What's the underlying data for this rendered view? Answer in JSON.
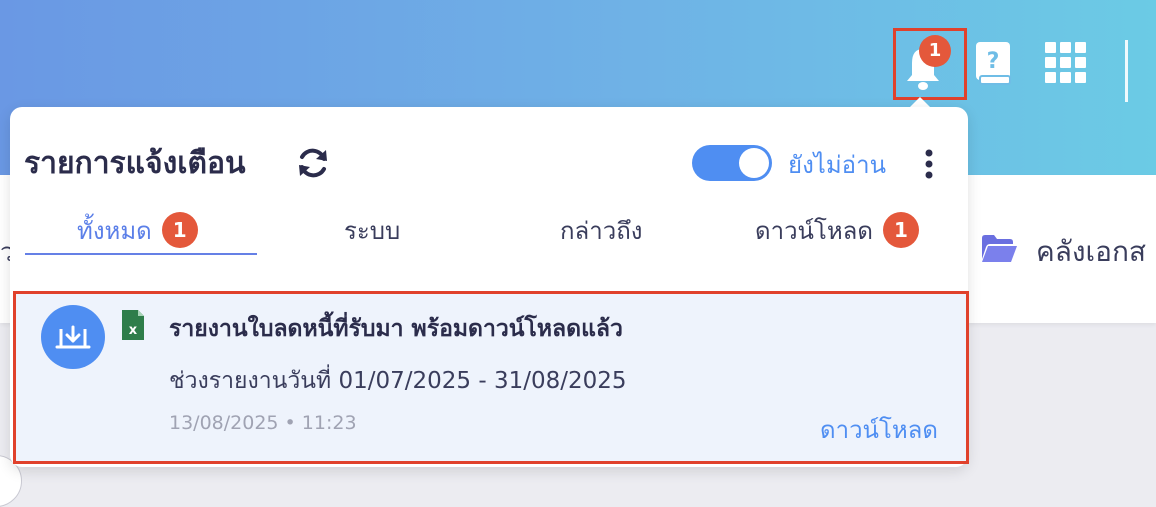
{
  "header": {
    "notifications_badge": "1",
    "icons": [
      "bell-icon",
      "help-book-icon",
      "apps-grid-icon"
    ]
  },
  "background": {
    "library_label": "คลังเอกส",
    "left_partial_char": "ว"
  },
  "notifications": {
    "title": "รายการแจ้งเตือน",
    "unread_toggle_label": "ยังไม่อ่าน",
    "unread_toggle_on": true,
    "tabs": [
      {
        "label": "ทั้งหมด",
        "badge": "1",
        "active": true
      },
      {
        "label": "ระบบ",
        "badge": null,
        "active": false
      },
      {
        "label": "กล่าวถึง",
        "badge": null,
        "active": false
      },
      {
        "label": "ดาวน์โหลด",
        "badge": "1",
        "active": false
      }
    ],
    "items": [
      {
        "title": "รายงานใบลดหนี้ที่รับมา พร้อมดาวน์โหลดแล้ว",
        "description": "ช่วงรายงานวันที่ 01/07/2025 - 31/08/2025",
        "timestamp": "13/08/2025 • 11:23",
        "action_label": "ดาวน์โหลด",
        "icon": "download-icon",
        "file_icon": "excel-file-icon"
      }
    ]
  },
  "colors": {
    "accent": "#4f8ef2",
    "badge": "#e4583b",
    "highlight_border": "#e0412c",
    "title_text": "#2b2c4b"
  }
}
